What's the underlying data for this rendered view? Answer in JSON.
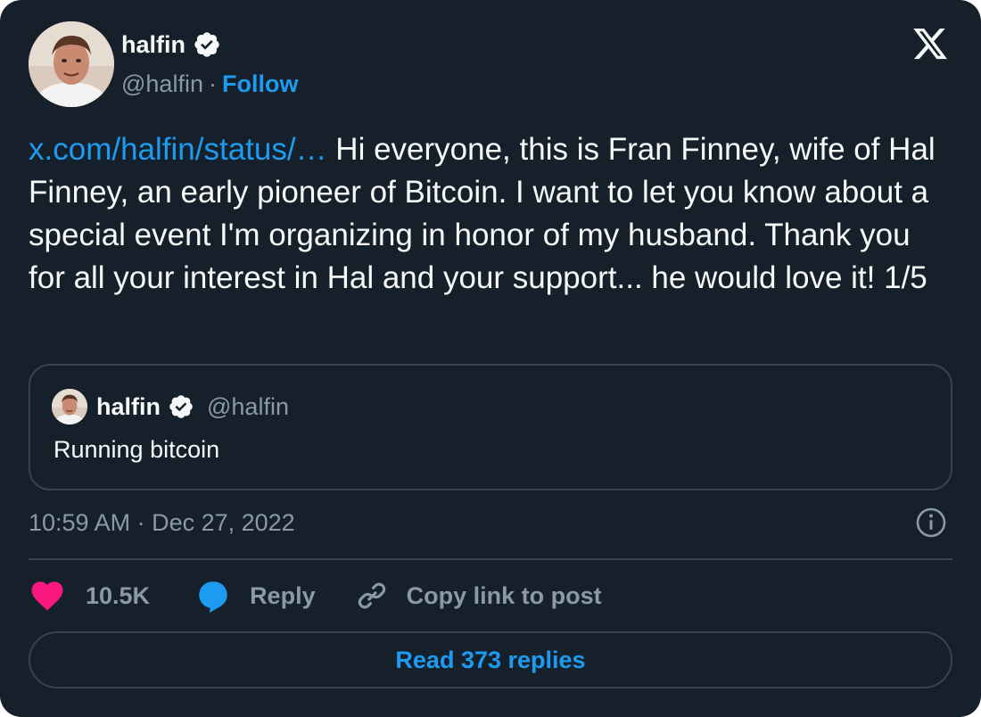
{
  "author": {
    "display_name": "halfin",
    "handle": "@halfin",
    "separator": "·",
    "follow_label": "Follow",
    "verified": true
  },
  "platform_icon": "x-logo-icon",
  "post": {
    "link_text": "x.com/halfin/status/…",
    "text": " Hi everyone, this is Fran Finney, wife of Hal Finney, an early pioneer of Bitcoin. I want to let you know about a special event I'm organizing in honor of my husband. Thank you for all your interest in Hal and your support... he would love it! 1/5"
  },
  "quoted_post": {
    "display_name": "halfin",
    "handle": "@halfin",
    "text": "Running bitcoin"
  },
  "timestamp": "10:59 AM · Dec 27, 2022",
  "actions": {
    "like_count": "10.5K",
    "reply_label": "Reply",
    "copy_link_label": "Copy link to post"
  },
  "read_replies_label": "Read 373 replies",
  "colors": {
    "background": "#15202b",
    "accent": "#1d9bf0",
    "like": "#f91880",
    "text": "#f7f9f9",
    "muted": "#8b98a5",
    "border": "#38444d"
  },
  "icons": [
    "verified-badge-icon",
    "x-logo-icon",
    "info-icon",
    "heart-icon",
    "reply-bubble-icon",
    "link-icon"
  ]
}
